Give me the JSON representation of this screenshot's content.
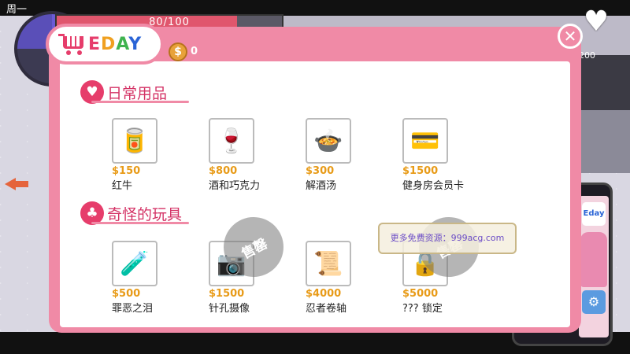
{
  "hud": {
    "weekday": "周一",
    "hp_text": "80/100",
    "hp_fraction": 0.8,
    "money_partial": "200"
  },
  "shop": {
    "logo_text": {
      "e": "E",
      "d": "D",
      "a": "A",
      "y": "Y"
    },
    "coin_count": "0",
    "close_label": "✕",
    "categories": [
      {
        "title": "日常用品",
        "icon": "heart-icon",
        "items": [
          {
            "price": "$150",
            "name": "红牛",
            "icon": "energy-drink-can-icon",
            "glyph": "🥫"
          },
          {
            "price": "$800",
            "name": "酒和巧克力",
            "icon": "wine-chocolate-icon",
            "glyph": "🍷"
          },
          {
            "price": "$300",
            "name": "解酒汤",
            "icon": "soup-bowl-icon",
            "glyph": "🍲"
          },
          {
            "price": "$1500",
            "name": "健身房会员卡",
            "icon": "membership-card-icon",
            "glyph": "💳"
          }
        ]
      },
      {
        "title": "奇怪的玩具",
        "icon": "mushroom-icon",
        "items": [
          {
            "price": "$500",
            "name": "罪恶之泪",
            "icon": "potion-bottle-icon",
            "glyph": "🧪"
          },
          {
            "price": "$1500",
            "name": "针孔摄像",
            "icon": "hidden-camera-icon",
            "glyph": "📷",
            "sold_out": "售罄"
          },
          {
            "price": "$4000",
            "name": "忍者卷轴",
            "icon": "ninja-scroll-icon",
            "glyph": "📜"
          },
          {
            "price": "$5000",
            "name": "??? 锁定",
            "icon": "locked-item-icon",
            "glyph": "🔒",
            "sold_out": "售罄"
          }
        ]
      }
    ]
  },
  "overlay": {
    "ad_text": "更多免费资源：999acg.com"
  },
  "phone": {
    "app_label": "Eday"
  },
  "colors": {
    "panel_pink": "#f08aa6",
    "accent_red": "#e63d6b",
    "price_orange": "#e89b18"
  }
}
